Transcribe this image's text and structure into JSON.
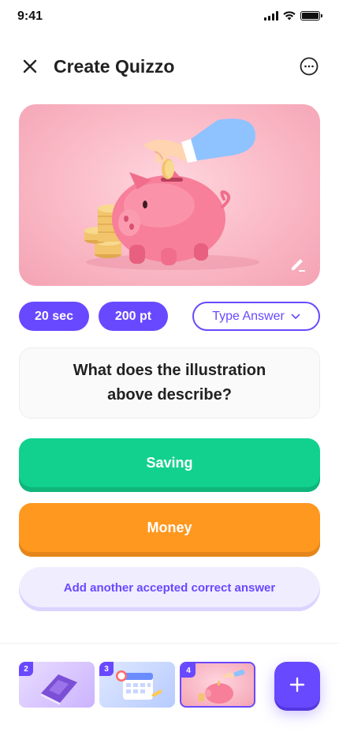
{
  "status_bar": {
    "time": "9:41"
  },
  "header": {
    "title": "Create Quizzo"
  },
  "question": {
    "time_limit": "20 sec",
    "points": "200 pt",
    "answer_type": "Type Answer",
    "text": "What does the illustration above describe?"
  },
  "answers": [
    {
      "label": "Saving",
      "color": "#12d18e"
    },
    {
      "label": "Money",
      "color": "#ff981f"
    }
  ],
  "add_answer_label": "Add another accepted correct answer",
  "slides": [
    {
      "number": "2"
    },
    {
      "number": "3"
    },
    {
      "number": "4"
    }
  ],
  "colors": {
    "primary": "#6949ff",
    "green": "#12d18e",
    "orange": "#ff981f"
  },
  "icons": {
    "close": "close-icon",
    "more": "more-horizontal-icon",
    "edit": "edit-pencil-icon",
    "dropdown": "chevron-down-icon",
    "add": "plus-icon"
  }
}
